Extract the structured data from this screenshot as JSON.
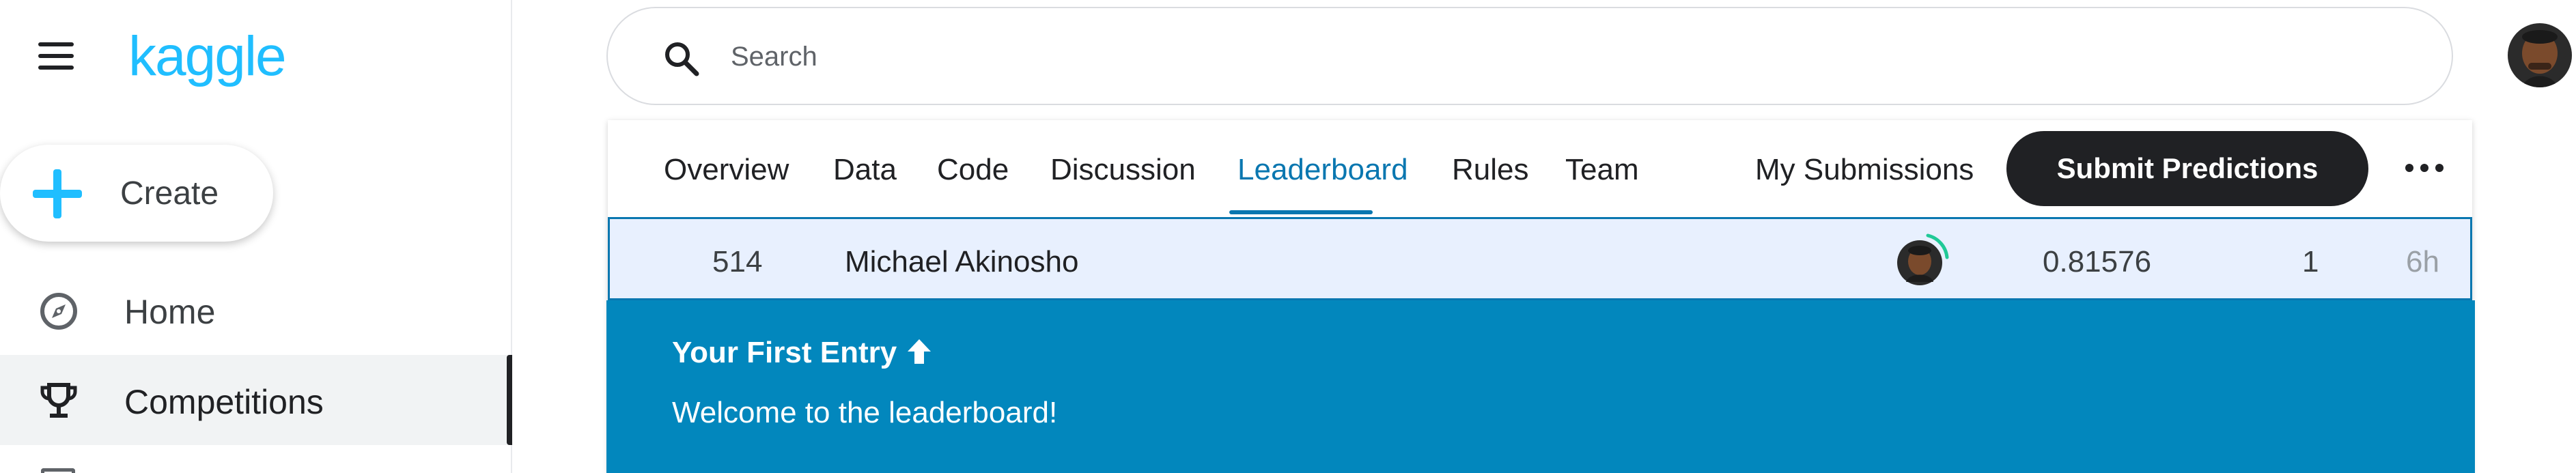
{
  "app": {
    "logo": "kaggle"
  },
  "sidebar": {
    "create_label": "Create",
    "items": [
      {
        "label": "Home",
        "icon": "compass-icon"
      },
      {
        "label": "Competitions",
        "icon": "trophy-icon",
        "active": true
      }
    ]
  },
  "search": {
    "placeholder": "Search"
  },
  "competition": {
    "tabs": [
      "Overview",
      "Data",
      "Code",
      "Discussion",
      "Leaderboard",
      "Rules",
      "Team"
    ],
    "active_tab": "Leaderboard",
    "my_submissions_label": "My Submissions",
    "submit_label": "Submit Predictions"
  },
  "leaderboard_row": {
    "rank": "514",
    "team_name": "Michael Akinosho",
    "score": "0.81576",
    "entries": "1",
    "last": "6h"
  },
  "banner": {
    "title": "Your First Entry",
    "message": "Welcome to the leaderboard!"
  },
  "colors": {
    "brand": "#20beff",
    "active_tab": "#0a77b0",
    "banner_bg": "#0287bd",
    "row_highlight": "#e8f0fe",
    "submit_bg": "#202124"
  }
}
